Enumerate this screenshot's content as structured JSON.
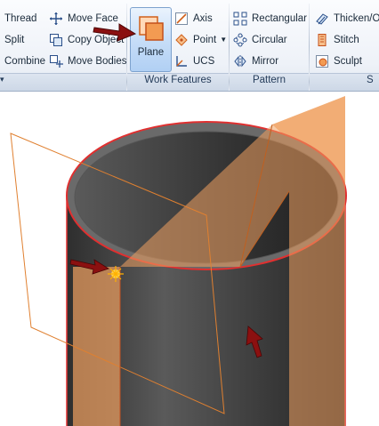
{
  "ribbon": {
    "modify": {
      "thread": "Thread",
      "split": "Split",
      "combine": "Combine",
      "move_face": "Move Face",
      "copy_object": "Copy Object",
      "move_bodies": "Move Bodies"
    },
    "work_features": {
      "plane": "Plane",
      "axis": "Axis",
      "point": "Point",
      "ucs": "UCS",
      "label": "Work Features"
    },
    "pattern": {
      "rectangular": "Rectangular",
      "circular": "Circular",
      "mirror": "Mirror",
      "label": "Pattern"
    },
    "surface": {
      "thicken": "Thicken/Of",
      "stitch": "Stitch",
      "sculpt": "Sculpt",
      "label": "S"
    }
  },
  "colors": {
    "cylinder": "#3f3f3f",
    "plane_fill": "#f0a060",
    "edge_red": "#e03030",
    "arrow": "#8b1010",
    "ribbon_bg": "#eef2f8"
  }
}
